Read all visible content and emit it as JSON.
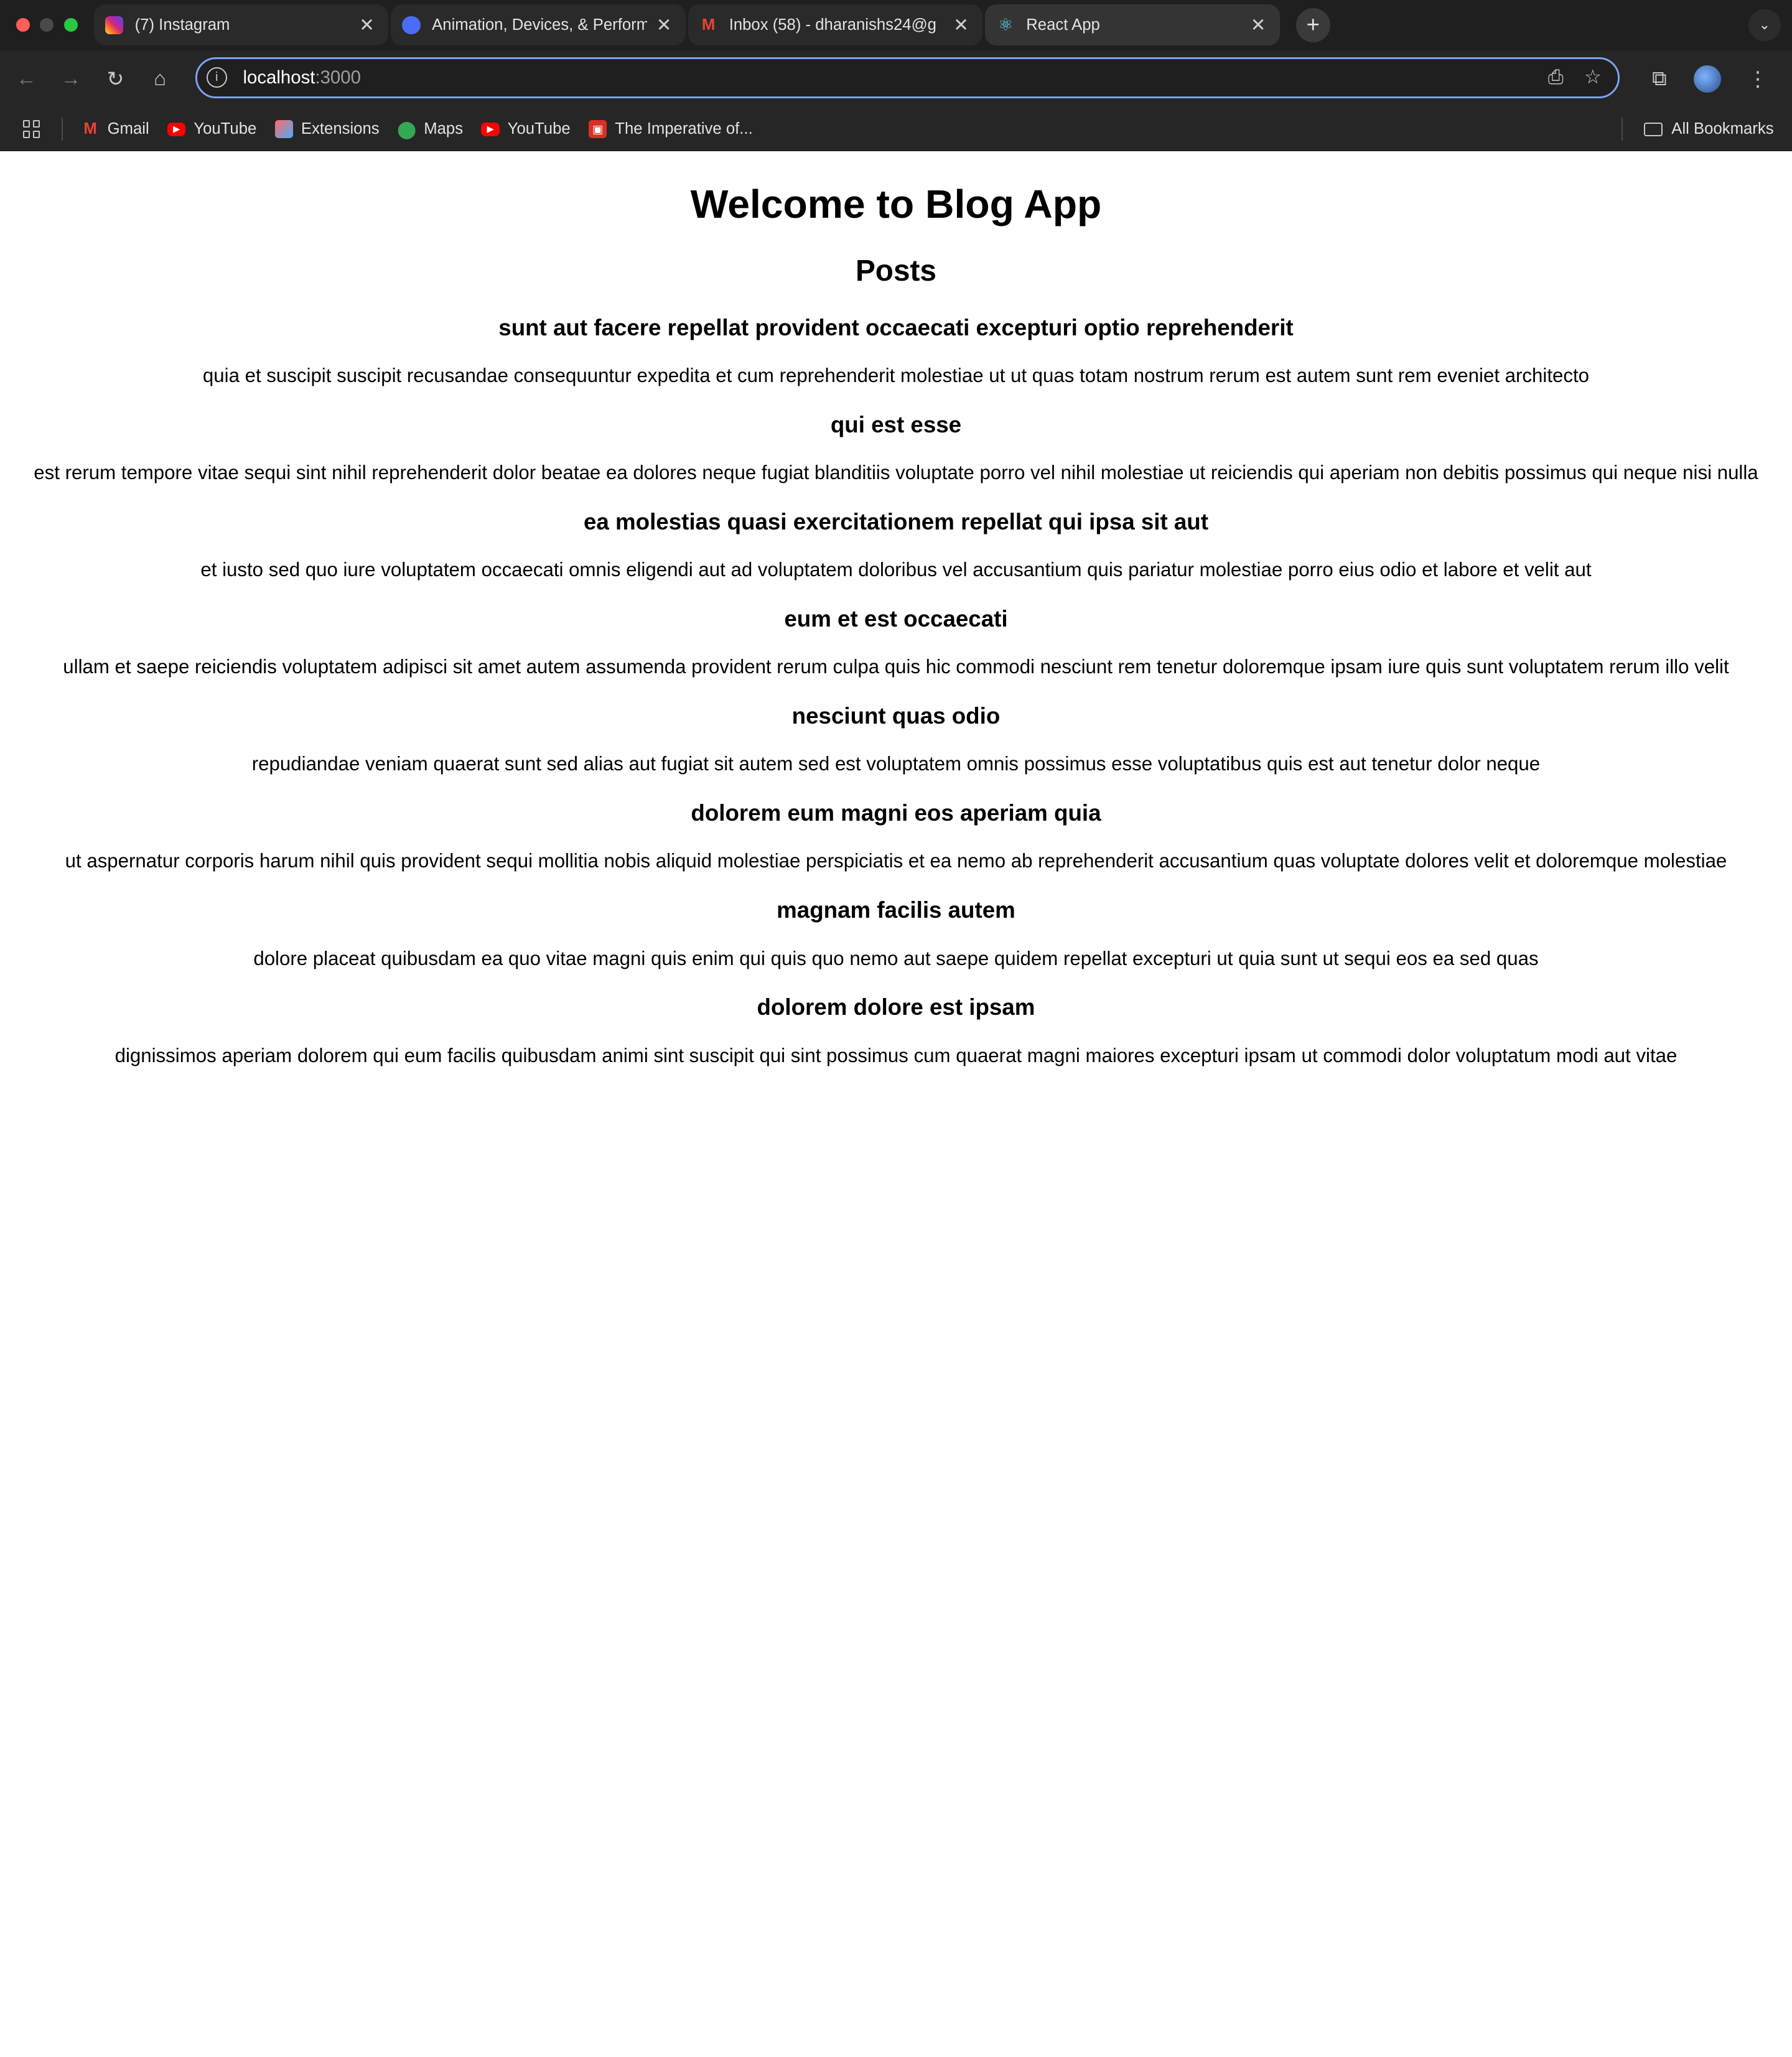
{
  "browser": {
    "tabs": [
      {
        "title": "(7) Instagram",
        "icon": "instagram-icon"
      },
      {
        "title": "Animation, Devices, & Perform",
        "icon": "animation-icon"
      },
      {
        "title": "Inbox (58) - dharanishs24@g",
        "icon": "gmail-icon"
      },
      {
        "title": "React App",
        "icon": "react-icon",
        "active": true
      }
    ],
    "address": {
      "host": "localhost",
      "port": ":3000"
    },
    "bookmarks": [
      {
        "label": "Gmail",
        "icon": "gmail-icon"
      },
      {
        "label": "YouTube",
        "icon": "youtube-icon"
      },
      {
        "label": "Extensions",
        "icon": "extensions-icon"
      },
      {
        "label": "Maps",
        "icon": "maps-icon"
      },
      {
        "label": "YouTube",
        "icon": "youtube-icon"
      },
      {
        "label": "The Imperative of...",
        "icon": "imperative-icon"
      }
    ],
    "all_bookmarks": "All Bookmarks"
  },
  "page": {
    "title": "Welcome to Blog App",
    "posts_heading": "Posts",
    "posts": [
      {
        "title": "sunt aut facere repellat provident occaecati excepturi optio reprehenderit",
        "body": "quia et suscipit suscipit recusandae consequuntur expedita et cum reprehenderit molestiae ut ut quas totam nostrum rerum est autem sunt rem eveniet architecto"
      },
      {
        "title": "qui est esse",
        "body": "est rerum tempore vitae sequi sint nihil reprehenderit dolor beatae ea dolores neque fugiat blanditiis voluptate porro vel nihil molestiae ut reiciendis qui aperiam non debitis possimus qui neque nisi nulla"
      },
      {
        "title": "ea molestias quasi exercitationem repellat qui ipsa sit aut",
        "body": "et iusto sed quo iure voluptatem occaecati omnis eligendi aut ad voluptatem doloribus vel accusantium quis pariatur molestiae porro eius odio et labore et velit aut"
      },
      {
        "title": "eum et est occaecati",
        "body": "ullam et saepe reiciendis voluptatem adipisci sit amet autem assumenda provident rerum culpa quis hic commodi nesciunt rem tenetur doloremque ipsam iure quis sunt voluptatem rerum illo velit"
      },
      {
        "title": "nesciunt quas odio",
        "body": "repudiandae veniam quaerat sunt sed alias aut fugiat sit autem sed est voluptatem omnis possimus esse voluptatibus quis est aut tenetur dolor neque"
      },
      {
        "title": "dolorem eum magni eos aperiam quia",
        "body": "ut aspernatur corporis harum nihil quis provident sequi mollitia nobis aliquid molestiae perspiciatis et ea nemo ab reprehenderit accusantium quas voluptate dolores velit et doloremque molestiae"
      },
      {
        "title": "magnam facilis autem",
        "body": "dolore placeat quibusdam ea quo vitae magni quis enim qui quis quo nemo aut saepe quidem repellat excepturi ut quia sunt ut sequi eos ea sed quas"
      },
      {
        "title": "dolorem dolore est ipsam",
        "body": "dignissimos aperiam dolorem qui eum facilis quibusdam animi sint suscipit qui sint possimus cum quaerat magni maiores excepturi ipsam ut commodi dolor voluptatum modi aut vitae"
      }
    ]
  }
}
